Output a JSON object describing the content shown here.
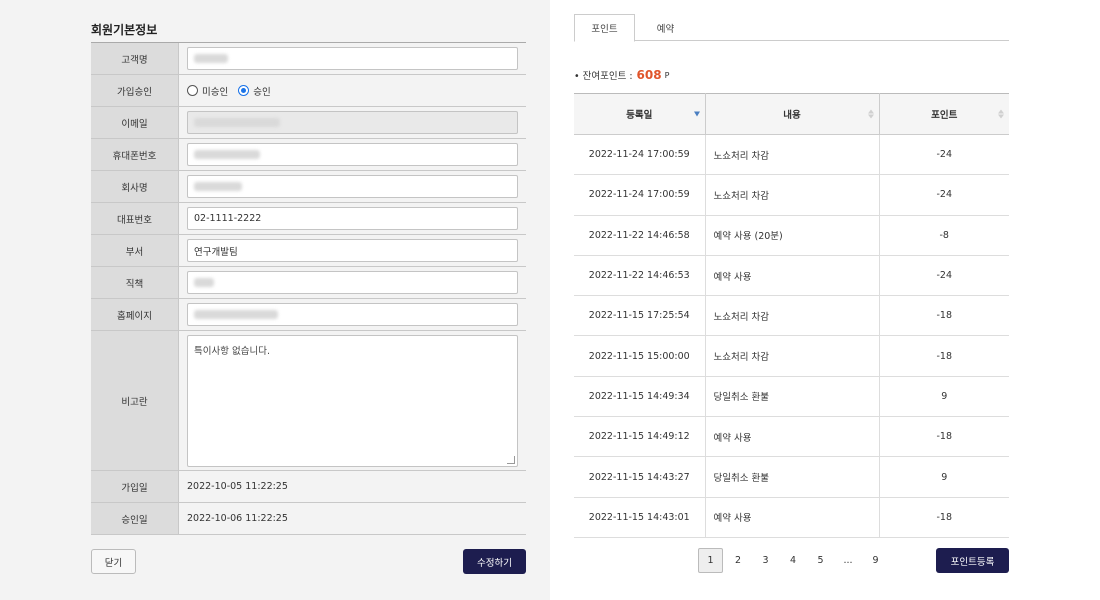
{
  "member_info": {
    "title": "회원기본정보",
    "labels": {
      "customer_name": "고객명",
      "approval": "가입승인",
      "email": "이메일",
      "mobile": "휴대폰번호",
      "company": "회사명",
      "main_phone": "대표번호",
      "department": "부서",
      "position": "직책",
      "homepage": "홈페이지",
      "remarks": "비고란",
      "join_date": "가입일",
      "approval_date": "승인일"
    },
    "approval_options": [
      "미승인",
      "승인"
    ],
    "approval_selected": "승인",
    "values": {
      "main_phone": "02-1111-2222",
      "department": "연구개발팀",
      "remarks": "특이사항 없습니다.",
      "join_date": "2022-10-05 11:22:25",
      "approval_date": "2022-10-06 11:22:25"
    },
    "buttons": {
      "close": "닫기",
      "edit": "수정하기"
    }
  },
  "tabs": [
    {
      "label": "포인트",
      "active": true
    },
    {
      "label": "예약",
      "active": false
    }
  ],
  "points": {
    "summary_label": "• 잔여포인트 :",
    "remaining": "608",
    "unit": "P",
    "columns": {
      "date": "등록일",
      "content": "내용",
      "point": "포인트"
    },
    "rows": [
      {
        "date": "2022-11-24 17:00:59",
        "content": "노쇼처리 차감",
        "point": "-24"
      },
      {
        "date": "2022-11-24 17:00:59",
        "content": "노쇼처리 차감",
        "point": "-24"
      },
      {
        "date": "2022-11-22 14:46:58",
        "content": "예약 사용 (20분)",
        "point": "-8"
      },
      {
        "date": "2022-11-22 14:46:53",
        "content": "예약 사용",
        "point": "-24"
      },
      {
        "date": "2022-11-15 17:25:54",
        "content": "노쇼처리 차감",
        "point": "-18"
      },
      {
        "date": "2022-11-15 15:00:00",
        "content": "노쇼처리 차감",
        "point": "-18"
      },
      {
        "date": "2022-11-15 14:49:34",
        "content": "당일취소 환불",
        "point": "9"
      },
      {
        "date": "2022-11-15 14:49:12",
        "content": "예약 사용",
        "point": "-18"
      },
      {
        "date": "2022-11-15 14:43:27",
        "content": "당일취소 환불",
        "point": "9"
      },
      {
        "date": "2022-11-15 14:43:01",
        "content": "예약 사용",
        "point": "-18"
      }
    ],
    "pagination": {
      "pages": [
        "1",
        "2",
        "3",
        "4",
        "5",
        "...",
        "9"
      ],
      "current": "1"
    },
    "register_button": "포인트등록"
  },
  "colors": {
    "primary_button": "#1d1d4f",
    "points_highlight": "#e0552b",
    "sort_active": "#4a7fc1",
    "left_background": "#f3f3f3"
  }
}
